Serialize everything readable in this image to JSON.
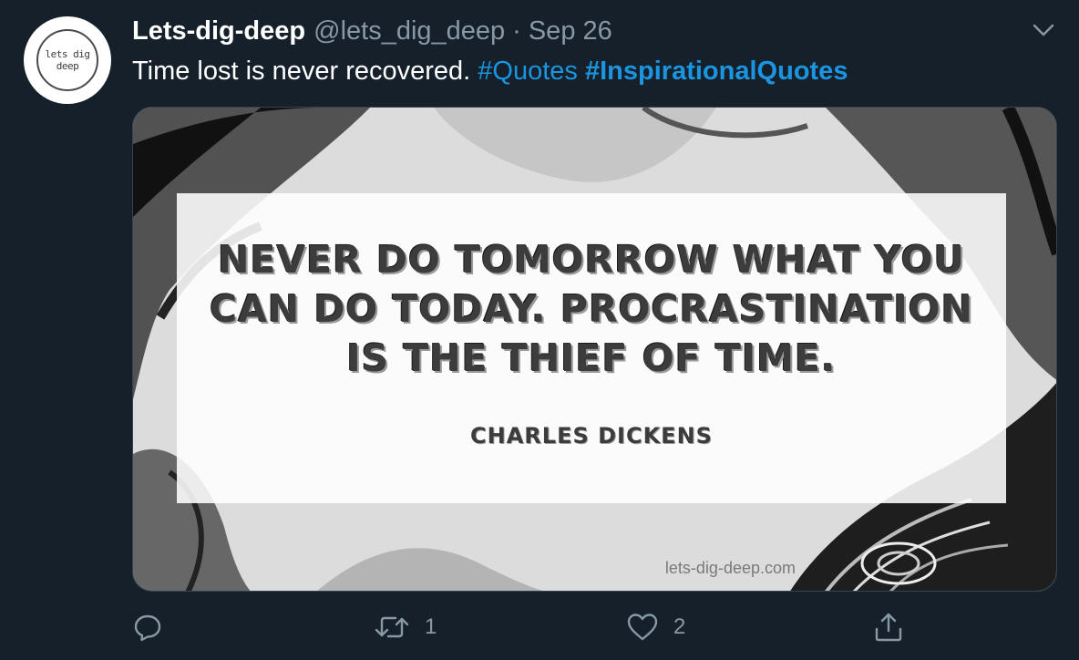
{
  "avatar": {
    "text_line1": "lets dig",
    "text_line2": "deep"
  },
  "header": {
    "display_name": "Lets-dig-deep",
    "handle": "@lets_dig_deep",
    "separator": "·",
    "date": "Sep 26"
  },
  "tweet": {
    "text": "Time lost is never recovered.",
    "hashtags": [
      "#Quotes",
      "#InspirationalQuotes"
    ]
  },
  "media": {
    "quote_line1": "NEVER DO TOMORROW WHAT YOU",
    "quote_line2": "CAN DO TODAY. PROCRASTINATION",
    "quote_line3": "IS THE THIEF OF TIME.",
    "author": "CHARLES DICKENS",
    "watermark": "lets-dig-deep.com"
  },
  "actions": {
    "reply_icon": "reply-icon",
    "retweet_icon": "retweet-icon",
    "retweet_count": "1",
    "like_icon": "heart-icon",
    "like_count": "2",
    "share_icon": "share-icon"
  },
  "colors": {
    "background": "#15202b",
    "secondary_text": "#8899a6",
    "link": "#1b95e0"
  }
}
